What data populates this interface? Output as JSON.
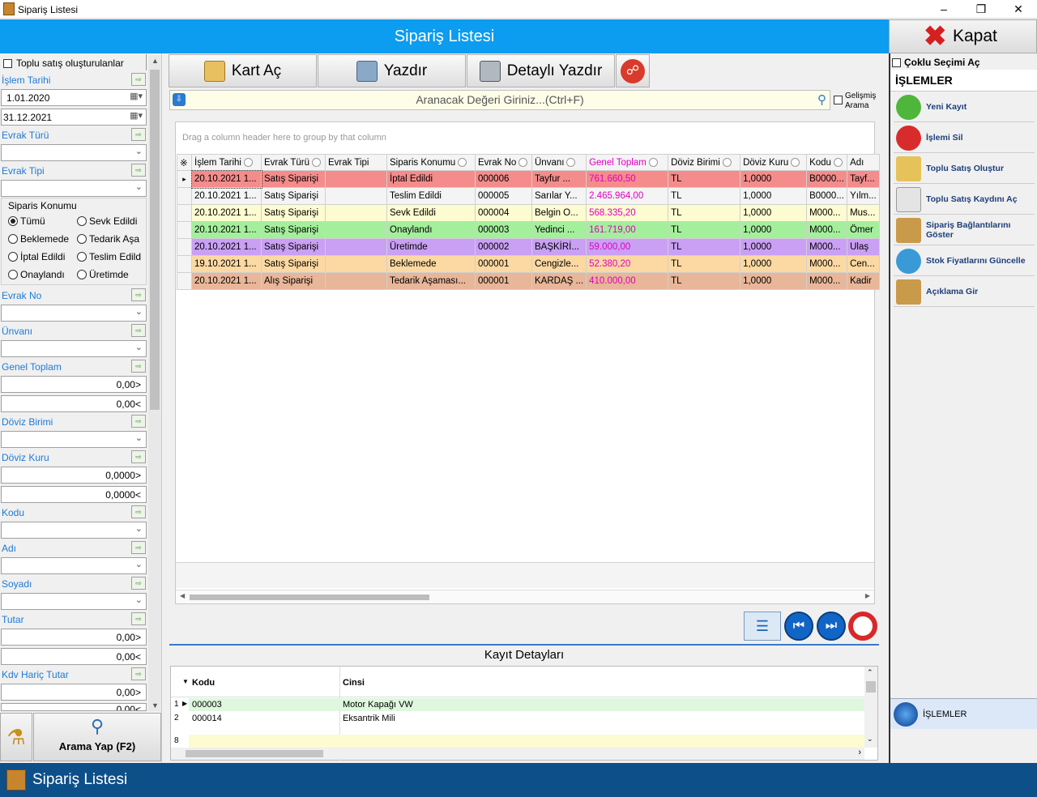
{
  "window": {
    "title": "Sipariş Listesi"
  },
  "header": {
    "title": "Sipariş Listesi",
    "close_label": "Kapat"
  },
  "left": {
    "bulk_check": "Toplu satış oluşturulanlar",
    "islem_tarihi": "İşlem Tarihi",
    "date_from": "1.01.2020",
    "date_to": "31.12.2021",
    "evrak_turu": "Evrak Türü",
    "evrak_tipi": "Evrak Tipi",
    "siparis_konumu": "Siparis Konumu",
    "radios": [
      "Tümü",
      "Sevk Edildi",
      "Beklemede",
      "Tedarik Aşa",
      "İptal Edildi",
      "Teslim Edild",
      "Onaylandı",
      "Üretimde"
    ],
    "evrak_no": "Evrak No",
    "unvani": "Ünvanı",
    "genel_toplam": "Genel Toplam",
    "gt_min": "0,00>",
    "gt_max": "0,00<",
    "doviz_birimi": "Döviz Birimi",
    "doviz_kuru": "Döviz Kuru",
    "dk_min": "0,0000>",
    "dk_max": "0,0000<",
    "kodu": "Kodu",
    "adi": "Adı",
    "soyadi": "Soyadı",
    "tutar": "Tutar",
    "t_min": "0,00>",
    "t_max": "0,00<",
    "kdv": "Kdv Hariç Tutar",
    "kdv_min": "0,00>",
    "kdv_max": "0,00<",
    "search_button": "Arama Yap (F2)"
  },
  "toolbar": {
    "kart_ac": "Kart Aç",
    "yazdir": "Yazdır",
    "detayli": "Detaylı Yazdır"
  },
  "search": {
    "placeholder": "Aranacak Değeri Giriniz...(Ctrl+F)",
    "advanced": "Gelişmiş Arama"
  },
  "grid": {
    "group_hint": "Drag a column header here to group by that column",
    "columns": [
      "İşlem Tarihi",
      "Evrak Türü",
      "Evrak Tipi",
      "Siparis Konumu",
      "Evrak No",
      "Ünvanı",
      "Genel Toplam",
      "Döviz Birimi",
      "Döviz Kuru",
      "Kodu",
      "Adı"
    ],
    "rows": [
      {
        "color": "#f48c8c",
        "cells": [
          "20.10.2021 1...",
          "Satış Siparişi",
          "",
          "İptal Edildi",
          "000006",
          "Tayfur ...",
          "761.660,50",
          "TL",
          "1,0000",
          "B0000...",
          "Tayf..."
        ]
      },
      {
        "color": "#f4f4f4",
        "cells": [
          "20.10.2021 1...",
          "Satış Siparişi",
          "",
          "Teslim Edildi",
          "000005",
          "Sarılar Y...",
          "2.465.964,00",
          "TL",
          "1,0000",
          "B0000...",
          "Yılm..."
        ]
      },
      {
        "color": "#fdfbd0",
        "cells": [
          "20.10.2021 1...",
          "Satış Siparişi",
          "",
          "Sevk Edildi",
          "000004",
          "Belgin O...",
          "568.335,20",
          "TL",
          "1,0000",
          "M000...",
          "Mus..."
        ]
      },
      {
        "color": "#a4ef9c",
        "cells": [
          "20.10.2021 1...",
          "Satış Siparişi",
          "",
          "Onaylandı",
          "000003",
          "Yedinci ...",
          "161.719,00",
          "TL",
          "1,0000",
          "M000...",
          "Ömer"
        ]
      },
      {
        "color": "#c9a0f4",
        "cells": [
          "20.10.2021 1...",
          "Satış Siparişi",
          "",
          "Üretimde",
          "000002",
          "BAŞKİRİ...",
          "59.000,00",
          "TL",
          "1,0000",
          "M000...",
          "Ulaş"
        ]
      },
      {
        "color": "#fcd9a2",
        "cells": [
          "19.10.2021 1...",
          "Satış Siparişi",
          "",
          "Beklemede",
          "000001",
          "Cengizle...",
          "52.380,20",
          "TL",
          "1,0000",
          "M000...",
          "Cen..."
        ]
      },
      {
        "color": "#e8b698",
        "cells": [
          "20.10.2021 1...",
          "Alış Siparişi",
          "",
          "Tedarik Aşaması...",
          "000001",
          "KARDAŞ ...",
          "410.000,00",
          "TL",
          "1,0000",
          "M000...",
          "Kadir"
        ]
      }
    ]
  },
  "details": {
    "title": "Kayıt Detayları",
    "col_kodu": "Kodu",
    "col_cinsi": "Cinsi",
    "rows": [
      {
        "n": "1",
        "kodu": "000003",
        "cinsi": "Motor Kapağı VW"
      },
      {
        "n": "2",
        "kodu": "000014",
        "cinsi": "Eksantrik Mili"
      }
    ],
    "new_row": "8"
  },
  "right": {
    "multi_select": "Çoklu Seçimi Aç",
    "section": "İŞLEMLER",
    "items": [
      "Yeni Kayıt",
      "İşlemi Sil",
      "Toplu Satış Oluştur",
      "Toplu Satış Kaydını Aç",
      "Sipariş Bağlantılarını Göster",
      "Stok Fiyatlarını Güncelle",
      "Açıklama Gir"
    ],
    "bottom": "İŞLEMLER"
  },
  "status": {
    "title": "Sipariş Listesi"
  }
}
